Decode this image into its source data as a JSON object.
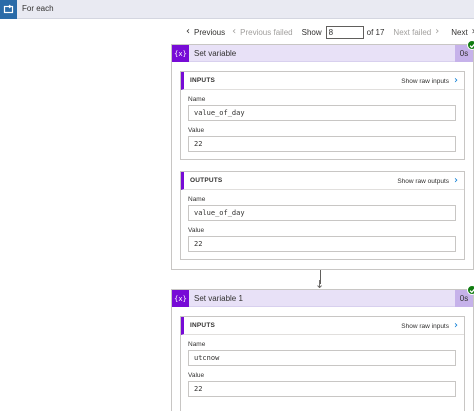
{
  "foreach": {
    "title": "For each"
  },
  "pager": {
    "previous": "Previous",
    "previous_failed": "Previous failed",
    "show": "Show",
    "current": "8",
    "of": "of 17",
    "next_failed": "Next failed",
    "next": "Next"
  },
  "actions": [
    {
      "title": "Set variable",
      "icon_text": "{x}",
      "duration": "0s",
      "status": "succeeded",
      "inputs": {
        "heading": "INPUTS",
        "raw_link": "Show raw inputs",
        "name_label": "Name",
        "name_value": "value_of_day",
        "value_label": "Value",
        "value_value": "22"
      },
      "outputs": {
        "heading": "OUTPUTS",
        "raw_link": "Show raw outputs",
        "name_label": "Name",
        "name_value": "value_of_day",
        "value_label": "Value",
        "value_value": "22"
      }
    },
    {
      "title": "Set variable 1",
      "icon_text": "{x}",
      "duration": "0s",
      "status": "succeeded",
      "inputs": {
        "heading": "INPUTS",
        "raw_link": "Show raw inputs",
        "name_label": "Name",
        "name_value": "utcnow",
        "value_label": "Value",
        "value_value": "22"
      }
    }
  ],
  "colors": {
    "accent_purple": "#770bd6",
    "header_purple": "#e8e1f7",
    "success_green": "#107c10",
    "link_blue": "#0078d4",
    "foreach_blue": "#2a6ba8"
  },
  "icons": {
    "foreach": "loop-icon",
    "variable": "variable-icon",
    "success": "check-icon",
    "chevron_left": "chevron-left-icon",
    "chevron_right": "chevron-right-icon"
  }
}
